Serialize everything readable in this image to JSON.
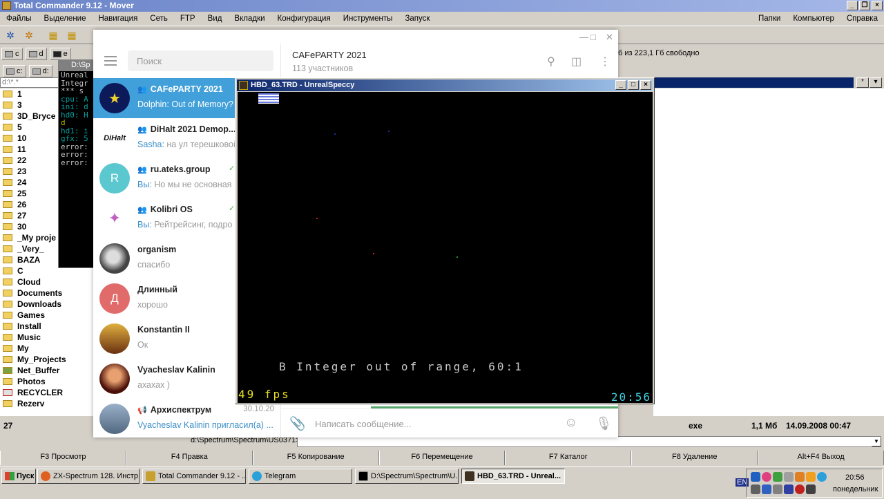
{
  "tc": {
    "title": "Total Commander 9.12 - Mover",
    "menu": [
      "Файлы",
      "Выделение",
      "Навигация",
      "Сеть",
      "FTP",
      "Вид",
      "Вкладки",
      "Конфигурация",
      "Инструменты",
      "Запуск"
    ],
    "menu_right": [
      "Папки",
      "Компьютер",
      "Справка"
    ],
    "drives_top": [
      "c",
      "d",
      "e"
    ],
    "drives_second": [
      "c:",
      "d:"
    ],
    "free_space": "б из 223,1 Гб свободно",
    "left_path": "d:\\*.*",
    "dirs": [
      "1",
      "3",
      "3D_Bryce",
      "5",
      "10",
      "11",
      "22",
      "23",
      "24",
      "25",
      "26",
      "27",
      "30",
      "_My proje",
      "_Very_",
      "BAZA",
      "C",
      "Cloud",
      "Documents",
      "Downloads",
      "Games",
      "Install",
      "Music",
      "My",
      "My_Projects",
      "Net_Buffer",
      "Photos",
      "RECYCLER",
      "Rezerv"
    ],
    "status_left": "27",
    "status_ext": "exe",
    "status_size": "1,1 Мб",
    "status_date": "14.09.2008 00:47",
    "cmd_path": "d:\\Spectrum\\Spectrum\\US0371>",
    "fkeys": [
      "F3 Просмотр",
      "F4 Правка",
      "F5 Копирование",
      "F6 Перемещение",
      "F7 Каталог",
      "F8 Удаление",
      "Alt+F4 Выход"
    ]
  },
  "console": {
    "title": "D:\\Sp",
    "lines": [
      {
        "text": "Unreal",
        "color": "#c0c0c0"
      },
      {
        "text": "Integr",
        "color": "#c0c0c0"
      },
      {
        "text": "",
        "color": "#c0c0c0"
      },
      {
        "text": " *** s",
        "color": "#c0c0c0"
      },
      {
        "text": "cpu: A",
        "color": "#00a0a0"
      },
      {
        "text": "ini: d",
        "color": "#00a0a0"
      },
      {
        "text": "hd0: H",
        "color": "#00a0a0"
      },
      {
        "text": "     d",
        "color": "#c0c000"
      },
      {
        "text": "hd1: i",
        "color": "#00a0a0"
      },
      {
        "text": "gfx: 5",
        "color": "#00a0a0"
      },
      {
        "text": "error:",
        "color": "#c0c0c0"
      },
      {
        "text": "error:",
        "color": "#c0c0c0"
      },
      {
        "text": "error:",
        "color": "#c0c0c0"
      }
    ]
  },
  "telegram": {
    "search_placeholder": "Поиск",
    "header_title": "CAFePARTY 2021",
    "header_sub": "113 участников",
    "compose_placeholder": "Написать сообщение...",
    "chats": [
      {
        "name": "CAFePARTY 2021",
        "group": true,
        "who": "",
        "preview": "Dolphin: Out of Memory?",
        "date": "",
        "avatar_color": "#0c1a5a",
        "avatar_text": "",
        "check": false
      },
      {
        "name": "DiHalt 2021 Demop...",
        "group": true,
        "who": "Sasha:",
        "preview": " на ул терешковой",
        "date": "",
        "avatar_color": "#ffffff",
        "avatar_text": "DiHalt",
        "check": false
      },
      {
        "name": "ru.ateks.group",
        "group": true,
        "who": "Вы:",
        "preview": " Но мы не основная",
        "date": "",
        "avatar_color": "#5bc8d0",
        "avatar_text": "R",
        "check": true
      },
      {
        "name": "Kolibri OS",
        "group": true,
        "who": "Вы:",
        "preview": " Рейтрейсинг, подро",
        "date": "",
        "avatar_color": "#ffffff",
        "avatar_text": "",
        "check": true
      },
      {
        "name": "organism",
        "group": false,
        "who": "",
        "preview": "спасибо",
        "date": "",
        "avatar_color": "#555555",
        "avatar_text": "",
        "check": false
      },
      {
        "name": "Длинный",
        "group": false,
        "who": "",
        "preview": "хорошо",
        "date": "",
        "avatar_color": "#e16a6a",
        "avatar_text": "Д",
        "check": false
      },
      {
        "name": "Konstantin II",
        "group": false,
        "who": "",
        "preview": "Ок",
        "date": "",
        "avatar_color": "#c89030",
        "avatar_text": "",
        "check": false
      },
      {
        "name": "Vyacheslav Kalinin",
        "group": false,
        "who": "",
        "preview": "ахахах )",
        "date": "",
        "avatar_color": "#802010",
        "avatar_text": "",
        "check": false
      },
      {
        "name": "Архиспектрум",
        "group": true,
        "who": "Vyacheslav Kalinin пригласил(а) ...",
        "preview": "",
        "date": "30.10.20",
        "avatar_color": "#7090b0",
        "avatar_text": "",
        "check": false
      }
    ]
  },
  "speccy": {
    "title": "HBD_63.TRD - UnrealSpeccy",
    "message": "B Integer out of range, 60:1",
    "fps": "49 fps",
    "time": "20:56"
  },
  "taskbar": {
    "start": "Пуск",
    "tasks": [
      "ZX-Spectrum 128. Инстр...",
      "Total Commander 9.12 - ...",
      "Telegram",
      "D:\\Spectrum\\Spectrum\\U...",
      "HBD_63.TRD - Unreal..."
    ],
    "lang": "EN",
    "time": "20:56",
    "day": "понедельник"
  }
}
